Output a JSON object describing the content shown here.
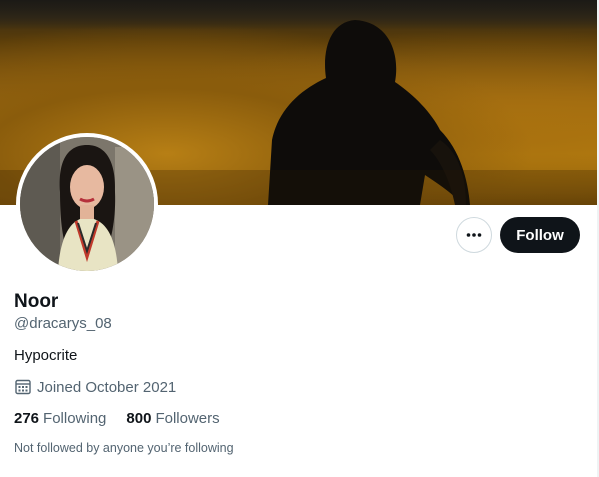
{
  "profile": {
    "name": "Noor",
    "handle": "@dracarys_08",
    "bio": "Hypocrite",
    "joined": "Joined October 2021",
    "following_count": "276",
    "following_label": "Following",
    "followers_count": "800",
    "followers_label": "Followers",
    "not_followed_text": "Not followed by anyone you’re following"
  },
  "actions": {
    "more_icon": "more-horizontal-icon",
    "follow_label": "Follow"
  },
  "icons": {
    "joined": "calendar-icon"
  },
  "colors": {
    "follow_button_bg": "#0f1419",
    "secondary_text": "#536471",
    "primary_text": "#0f1419"
  }
}
